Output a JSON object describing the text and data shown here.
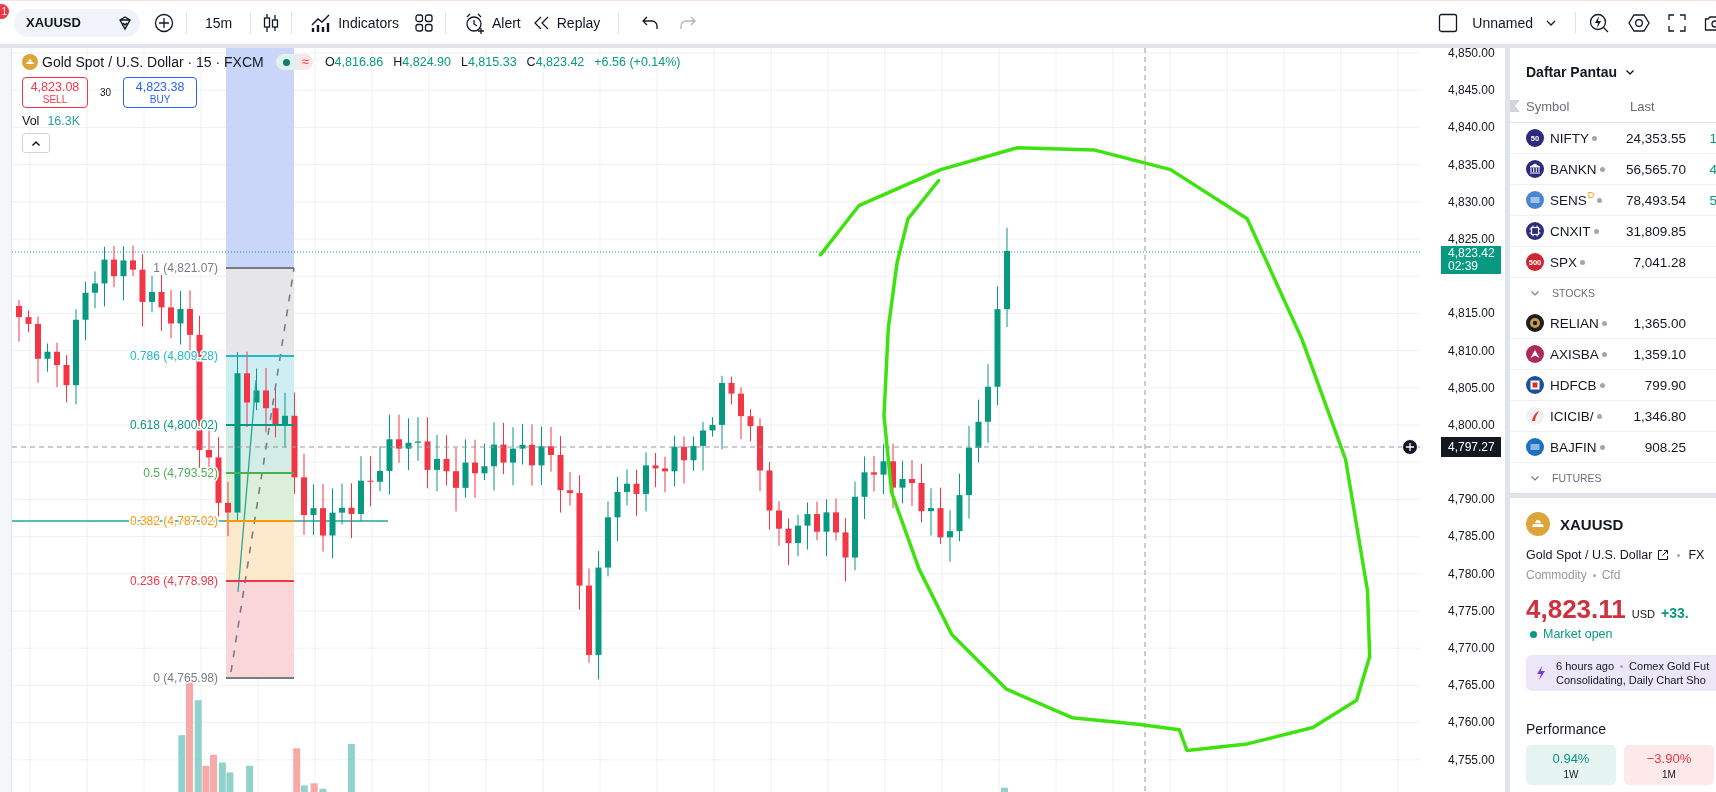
{
  "toolbar": {
    "notification_count": "1",
    "symbol": "XAUUSD",
    "interval": "15m",
    "indicators_label": "Indicators",
    "alert_label": "Alert",
    "replay_label": "Replay",
    "redo_disabled": true,
    "layout_name": "Unnamed"
  },
  "legend": {
    "title": "Gold Spot / U.S. Dollar · 15 · FXCM",
    "approx_symbol": "≈",
    "ohlc": [
      {
        "label": "O",
        "value": "4,816.86"
      },
      {
        "label": "H",
        "value": "4,824.90"
      },
      {
        "label": "L",
        "value": "4,815.33"
      },
      {
        "label": "C",
        "value": "4,823.42"
      }
    ],
    "change": "+6.56 (+0.14%)",
    "sell": {
      "price": "4,823.08",
      "label": "SELL"
    },
    "spread": "30",
    "buy": {
      "price": "4,823.38",
      "label": "BUY"
    },
    "volume": {
      "label": "Vol",
      "value": "16.3K"
    },
    "collapsed": false
  },
  "fib_levels": [
    {
      "ratio": "1",
      "price": "(4,821.07)",
      "color": "#787b86"
    },
    {
      "ratio": "0.786",
      "price": "(4,809.28)",
      "color": "#22b8cf"
    },
    {
      "ratio": "0.618",
      "price": "(4,800.02)",
      "color": "#089981"
    },
    {
      "ratio": "0.5",
      "price": "(4,793.52)",
      "color": "#4caf50"
    },
    {
      "ratio": "0.382",
      "price": "(4,787.02)",
      "color": "#ff9800"
    },
    {
      "ratio": "0.236",
      "price": "(4,778.98)",
      "color": "#f23645"
    },
    {
      "ratio": "0",
      "price": "(4,765.98)",
      "color": "#787b86"
    }
  ],
  "price_axis_upper": [
    "4,850.00",
    "4,845.00",
    "4,840.00",
    "4,835.00",
    "4,830.00",
    "4,825.00"
  ],
  "price_axis_middle": [
    "4,815.00",
    "4,810.00",
    "4,805.00",
    "4,800.00"
  ],
  "price_axis_lower": [
    "4,790.00",
    "4,785.00",
    "4,780.00",
    "4,775.00",
    "4,770.00",
    "4,765.00",
    "4,760.00",
    "4,755.00"
  ],
  "last_price_tag": {
    "price": "4,823.42",
    "countdown": "02:39"
  },
  "crosshair_tag": {
    "price": "4,797.27"
  },
  "watchlist": {
    "title": "Daftar Pantau",
    "columns": [
      "Symbol",
      "Last"
    ],
    "rows": [
      {
        "symbol": "NIFTY",
        "last": "24,353.55",
        "change": "1",
        "color": "#2e2a7d",
        "kind": "text",
        "icon_text": "50"
      },
      {
        "symbol": "BANKN",
        "last": "56,565.70",
        "change": "4",
        "color": "#2e2a7d",
        "kind": "bank"
      },
      {
        "symbol": "SENS",
        "flag": "D",
        "last": "78,493.54",
        "change": "5",
        "color": "#4a86d0",
        "kind": "bars"
      },
      {
        "symbol": "CNXIT",
        "last": "31,809.85",
        "color": "#2e2a7d",
        "kind": "chip"
      },
      {
        "symbol": "SPX",
        "last": "7,041.28",
        "color": "#d0262f",
        "kind": "text",
        "icon_text": "500"
      }
    ],
    "groups": [
      {
        "title": "STOCKS",
        "expanded": true,
        "rows": [
          {
            "symbol": "RELIAN",
            "last": "1,365.00",
            "color": "#1e1e1e",
            "kind": "ring"
          },
          {
            "symbol": "AXISBA",
            "last": "1,359.10",
            "color": "#ae2a5a",
            "kind": "chevron"
          },
          {
            "symbol": "HDFCB",
            "last": "799.90",
            "color": "#1f4e9e",
            "kind": "square"
          },
          {
            "symbol": "ICICIB/",
            "last": "1,346.80",
            "color": "#f1f1f4",
            "kind": "swoosh"
          },
          {
            "symbol": "BAJFIN",
            "last": "908.25",
            "color": "#1d6fc0",
            "kind": "bars"
          }
        ]
      },
      {
        "title": "FUTURES",
        "expanded": true
      }
    ]
  },
  "symbol_card": {
    "symbol": "XAUUSD",
    "name": "Gold Spot / U.S. Dollar",
    "exchange": "FX",
    "type": "Commodity",
    "subtype": "Cfd",
    "price": "4,823.11",
    "currency": "USD",
    "change": "+33.",
    "market_status": "Market open",
    "market_open": true,
    "news": {
      "time": "6 hours ago",
      "lines": [
        "Comex Gold Fut",
        "Consolidating, Daily Chart Sho"
      ]
    },
    "performance_title": "Performance",
    "performance": [
      {
        "value": "0.94%",
        "period": "1W",
        "kind": "gain"
      },
      {
        "value": "−3.90%",
        "period": "1M",
        "kind": "loss"
      }
    ]
  }
}
